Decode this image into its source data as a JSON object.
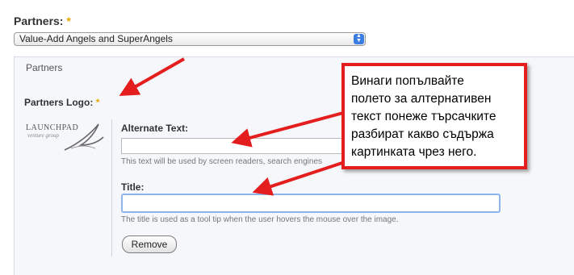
{
  "partners_field": {
    "label": "Partners:",
    "required_mark": "*"
  },
  "partners_select": {
    "selected_value": "Value-Add Angels and SuperAngels"
  },
  "fieldset": {
    "legend": "Partners"
  },
  "logo_field": {
    "label": "Partners Logo:",
    "required_mark": "*"
  },
  "logo_image": {
    "text": "LAUNCHPAD",
    "subtext": "venture group"
  },
  "alt_text": {
    "label": "Alternate Text:",
    "value": "",
    "description": "This text will be used by screen readers, search engines"
  },
  "title_field": {
    "label": "Title:",
    "value": "",
    "description": "The title is used as a tool tip when the user hovers the mouse over the image."
  },
  "remove_button": {
    "label": "Remove"
  },
  "callout": {
    "lines": [
      "Винаги попълвайте",
      "полето за алтернативен",
      "текст понеже търсачките",
      "разбират какво съдържа",
      "картинката чрез него."
    ],
    "border_color": "#e41e1e"
  },
  "arrow_color": "#e41e1e"
}
